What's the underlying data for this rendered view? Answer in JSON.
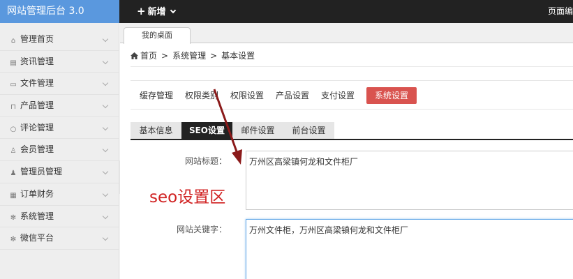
{
  "app": {
    "title": "网站管理后台 3.0"
  },
  "topbar": {
    "add_label": "新增",
    "right_label": "页面编"
  },
  "sidebar": {
    "items": [
      {
        "label": "管理首页",
        "icon": "home-icon"
      },
      {
        "label": "资讯管理",
        "icon": "news-icon"
      },
      {
        "label": "文件管理",
        "icon": "image-icon"
      },
      {
        "label": "产品管理",
        "icon": "bag-icon"
      },
      {
        "label": "评论管理",
        "icon": "comment-icon"
      },
      {
        "label": "会员管理",
        "icon": "user-icon"
      },
      {
        "label": "管理员管理",
        "icon": "admin-icon"
      },
      {
        "label": "订单财务",
        "icon": "cart-icon"
      },
      {
        "label": "系统管理",
        "icon": "gear-icon"
      },
      {
        "label": "微信平台",
        "icon": "gear-icon"
      }
    ]
  },
  "tabs": {
    "desk": "我的桌面"
  },
  "breadcrumb": {
    "home": "首页",
    "sep": ">",
    "level2": "系统管理",
    "level3": "基本设置"
  },
  "subnav": {
    "items": [
      "缓存管理",
      "权限类别",
      "权限设置",
      "产品设置",
      "支付设置",
      "系统设置"
    ],
    "active_index": 5,
    "active_color": "#d9534f"
  },
  "settings_tabs": {
    "items": [
      "基本信息",
      "SEO设置",
      "邮件设置",
      "前台设置"
    ],
    "active_index": 1
  },
  "form": {
    "site_title_label": "网站标题：",
    "site_title_value": "万州区高梁镇何龙和文件柜厂",
    "keywords_label": "网站关键字：",
    "keywords_value": "万州文件柜，万州区高梁镇何龙和文件柜厂"
  },
  "annotation": {
    "text": "seo设置区",
    "color": "#d02020"
  }
}
